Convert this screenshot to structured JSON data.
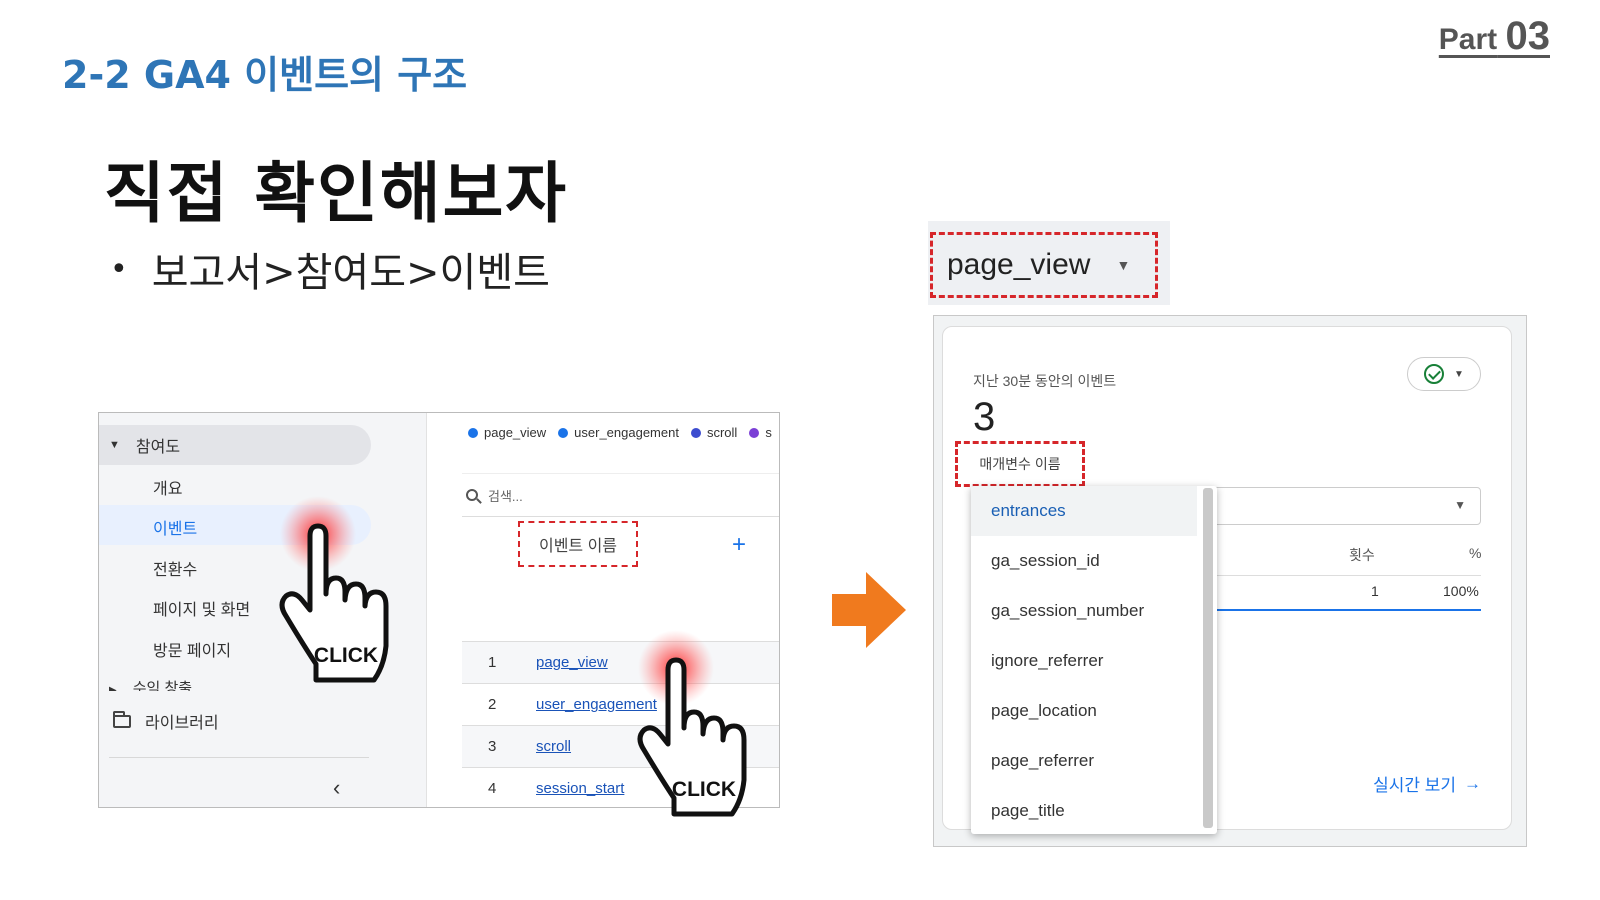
{
  "header": {
    "part_word": "Part",
    "part_number": "03",
    "section_title": "2-2 GA4 이벤트의 구조",
    "main_title": "직접 확인해보자",
    "bullet": "보고서>참여도>이벤트"
  },
  "left_screenshot": {
    "nav": {
      "group_label": "참여도",
      "items": [
        "개요",
        "이벤트",
        "전환수",
        "페이지 및 화면",
        "방문 페이지"
      ],
      "sub_group": "수익 창출",
      "library": "라이브러리"
    },
    "legend": [
      {
        "label": "page_view",
        "color": "#1a73e8"
      },
      {
        "label": "user_engagement",
        "color": "#1a73e8"
      },
      {
        "label": "scroll",
        "color": "#3c4ccf"
      },
      {
        "label": "s",
        "color": "#7b3fd6"
      }
    ],
    "search_placeholder": "검색...",
    "column_header": "이벤트 이름",
    "add_icon": "+",
    "rows": [
      {
        "index": "1",
        "name": "page_view"
      },
      {
        "index": "2",
        "name": "user_engagement"
      },
      {
        "index": "3",
        "name": "scroll"
      },
      {
        "index": "4",
        "name": "session_start"
      }
    ],
    "click_label": "CLICK"
  },
  "right_screenshot": {
    "event_dropdown": "page_view",
    "card_label": "지난 30분 동안의 이벤트",
    "count": "3",
    "param_label": "매개변수 이름",
    "col_count_header": "횟수",
    "col_pct_header": "%",
    "row_count": "1",
    "row_pct": "100%",
    "realtime_link": "실시간 보기",
    "menu_items": [
      "entrances",
      "ga_session_id",
      "ga_session_number",
      "ignore_referrer",
      "page_location",
      "page_referrer",
      "page_title"
    ]
  },
  "colors": {
    "accent_blue": "#2e75b6",
    "highlight_red": "#d6262a",
    "arrow_orange": "#f07a1e",
    "link_blue": "#1a73e8"
  }
}
